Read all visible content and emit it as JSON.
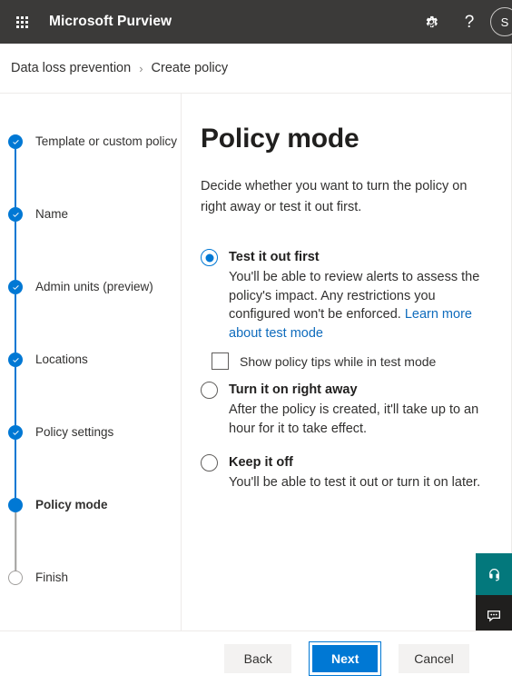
{
  "suite": {
    "waffle_icon": "app-launcher-waffle-icon",
    "title": "Microsoft Purview",
    "settings_icon": "gear-icon",
    "help_icon": "question-mark-icon",
    "avatar_initial": "S"
  },
  "breadcrumb": {
    "root": "Data loss prevention",
    "separator": "›",
    "current": "Create policy"
  },
  "stepper": {
    "items": [
      {
        "label": "Template or custom policy",
        "state": "complete"
      },
      {
        "label": "Name",
        "state": "complete"
      },
      {
        "label": "Admin units (preview)",
        "state": "complete"
      },
      {
        "label": "Locations",
        "state": "complete"
      },
      {
        "label": "Policy settings",
        "state": "complete"
      },
      {
        "label": "Policy mode",
        "state": "current"
      },
      {
        "label": "Finish",
        "state": "pending"
      }
    ]
  },
  "main": {
    "title": "Policy mode",
    "subtitle": "Decide whether you want to turn the policy on right away or test it out first.",
    "options": [
      {
        "title": "Test it out first",
        "description": "You'll be able to review alerts to assess the policy's impact. Any restrictions you configured won't be enforced. ",
        "link_text": "Learn more about test mode",
        "selected": true
      },
      {
        "title": "Turn it on right away",
        "description": "After the policy is created, it'll take up to an hour for it to take effect.",
        "link_text": "",
        "selected": false
      },
      {
        "title": "Keep it off",
        "description": "You'll be able to test it out or turn it on later.",
        "link_text": "",
        "selected": false
      }
    ],
    "checkbox": {
      "label": "Show policy tips while in test mode",
      "checked": false
    }
  },
  "floating": {
    "support_icon": "headset-icon",
    "feedback_icon": "chat-bubble-icon"
  },
  "footer": {
    "back_label": "Back",
    "next_label": "Next",
    "cancel_label": "Cancel"
  },
  "colors": {
    "suite_bar": "#3b3a39",
    "accent": "#0078d4",
    "link": "#0f6cbd",
    "support_widget": "#03787c",
    "feedback_widget": "#201f1e"
  }
}
